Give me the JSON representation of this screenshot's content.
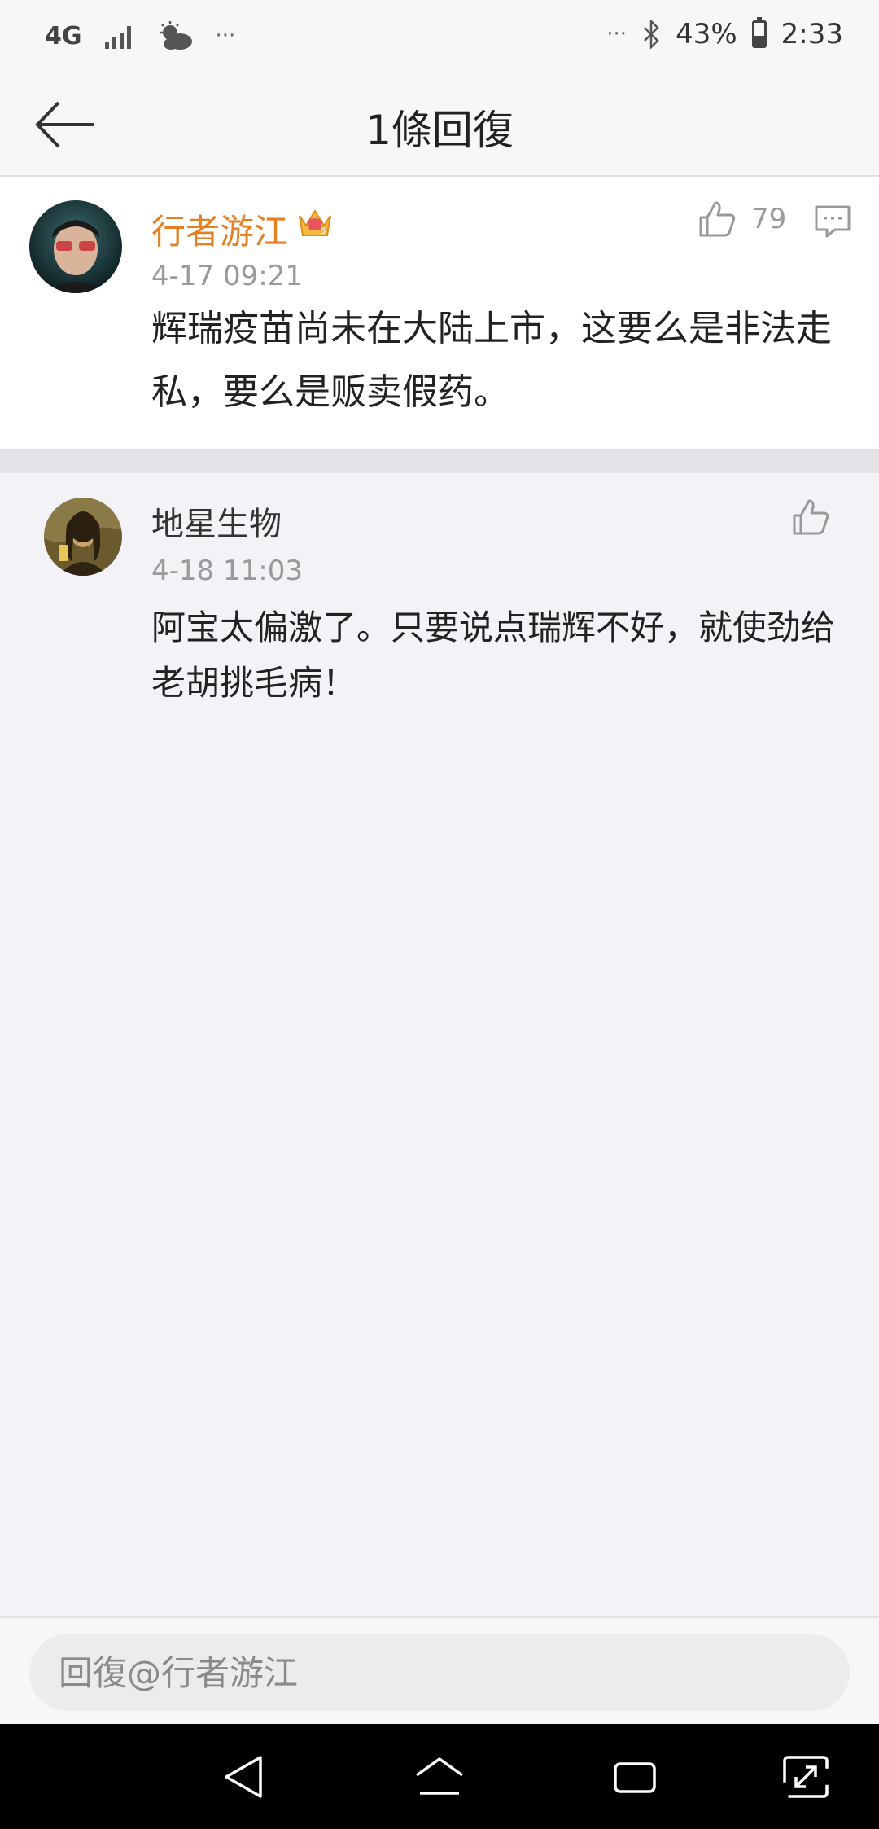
{
  "status_bar": {
    "network": "4G",
    "more_left": "···",
    "more_right": "···",
    "battery_percent": "43%",
    "battery_level": 0.43,
    "time": "2:33"
  },
  "header": {
    "title": "1條回復"
  },
  "main_comment": {
    "username": "行者游江",
    "username_color": "#e67e22",
    "timestamp": "4-17 09:21",
    "text": "辉瑞疫苗尚未在大陆上市，这要么是非法走私，要么是贩卖假药。",
    "like_count": "79"
  },
  "reply": {
    "username": "地星生物",
    "timestamp": "4-18 11:03",
    "text": "阿宝太偏激了。只要说点瑞辉不好，就使劲给老胡挑毛病！"
  },
  "input_bar": {
    "placeholder": "回復@行者游江"
  },
  "icons": {
    "back": "arrow-left-icon",
    "like": "thumbs-up-icon",
    "reply": "comment-icon",
    "crown": "crown-badge-icon",
    "nav_back": "triangle-back-icon",
    "nav_home": "home-icon",
    "nav_recent": "recent-apps-icon",
    "nav_expand": "expand-icon"
  }
}
